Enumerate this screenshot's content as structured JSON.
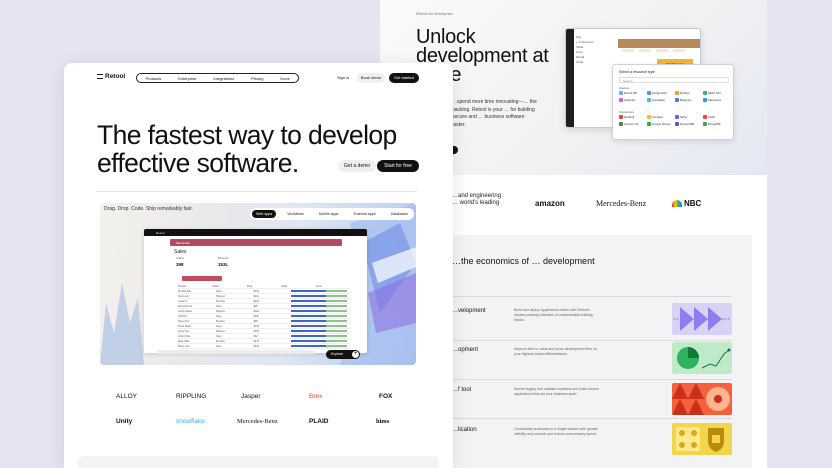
{
  "back": {
    "kicker": "Retool for Enterprise",
    "title": "Unlock development at scale",
    "body": "…spend more time innovating—… the backlog. Retool is your … for building secure and … business software faster.",
    "app": {
      "tree": [
        "App",
        "+ component",
        "Table",
        "Form",
        "Modal",
        "Chart"
      ],
      "button": "Add Resource"
    },
    "components": {
      "heading": "Select a resource type",
      "search": "Search",
      "sections": [
        "Queries",
        "Operations"
      ],
      "items": [
        "Retool DB",
        "PostgreSQL",
        "MySQL",
        "REST API",
        "GraphQL",
        "Snowflake",
        "BigQuery",
        "Salesforce",
        "Redshift",
        "Firebase",
        "Stripe",
        "Twilio",
        "Amazon S3",
        "Google Sheets",
        "DynamoDB",
        "MongoDB"
      ]
    },
    "logos_intro": "…and engineering … world's leading",
    "logos": [
      "amazon",
      "Mercedes-Benz",
      "NBC"
    ],
    "econ_title": "…the economics of … development",
    "rows": [
      {
        "label": "…velopment",
        "desc": "Build and deploy applications faster with Retool's industry-leading collection of customizable building blocks.",
        "color": "#c9c5f2"
      },
      {
        "label": "…opment",
        "desc": "Improve time to value and focus development time on your highest-impact differentiators.",
        "color": "#2db25e"
      },
      {
        "label": "…f tool",
        "desc": "Sunset legacy and outdated systems and build custom applications that set your business apart.",
        "color": "#f04a2a"
      },
      {
        "label": "…lication",
        "desc": "Consolidate processes to a single surface with greater visibility and controls and reduce unnecessary spend.",
        "color": "#e9c93a"
      }
    ]
  },
  "front": {
    "logo": "Retool",
    "nav": [
      "Products",
      "Enterprise",
      "Integrations",
      "Pricing",
      "Docs"
    ],
    "sign_in": "Sign in",
    "book_demo": "Book demo",
    "get_started": "Get started",
    "hero_title": "The fastest way to develop effective software.",
    "hero_demo": "Get a demo",
    "hero_start": "Start for free",
    "showcase_tag": "Drag. Drop. Code. Ship remarkably fast.",
    "tabs": [
      "Web apps",
      "Workflows",
      "Mobile apps",
      "External apps",
      "Databases"
    ],
    "active_tab": "Web apps",
    "inner_app": {
      "topbar": "Retool",
      "header": "Mercantile",
      "title": "Sales",
      "stats": [
        {
          "label": "Orders",
          "value": "398"
        },
        {
          "label": "Revenue",
          "value": "153L"
        }
      ],
      "columns": [
        "Product",
        "Status",
        "Price",
        "Stock",
        "Trend"
      ],
      "rows": [
        [
          "Air Max Plus",
          "Open",
          "$140",
          "",
          ""
        ],
        [
          "Dunk Low",
          "Shipped",
          "$110",
          "",
          ""
        ],
        [
          "Jordan 4",
          "Pending",
          "$210",
          "",
          ""
        ],
        [
          "Retro Runner",
          "Open",
          "$95",
          "",
          ""
        ],
        [
          "Court Classic",
          "Shipped",
          "$120",
          "",
          ""
        ],
        [
          "Trail Pro",
          "Open",
          "$160",
          "",
          ""
        ],
        [
          "Street Knit",
          "Pending",
          "$85",
          "",
          ""
        ],
        [
          "Cloud Racer",
          "Open",
          "$130",
          "",
          ""
        ],
        [
          "Zoom Flex",
          "Shipped",
          "$150",
          "",
          ""
        ],
        [
          "Urban Slide",
          "Open",
          "$60",
          "",
          ""
        ],
        [
          "Peak Hiker",
          "Pending",
          "$175",
          "",
          ""
        ],
        [
          "Metro Low",
          "Open",
          "$100",
          "",
          ""
        ]
      ]
    },
    "explore": "Explore",
    "explore_icon": "+",
    "logos_row1": [
      "ALLOY",
      "RIPPLING",
      "Jasper",
      "Brex",
      "FOX"
    ],
    "logos_row2": [
      "Unity",
      "snowflake",
      "Mercedes-Benz",
      "PLAID",
      "hims"
    ]
  }
}
